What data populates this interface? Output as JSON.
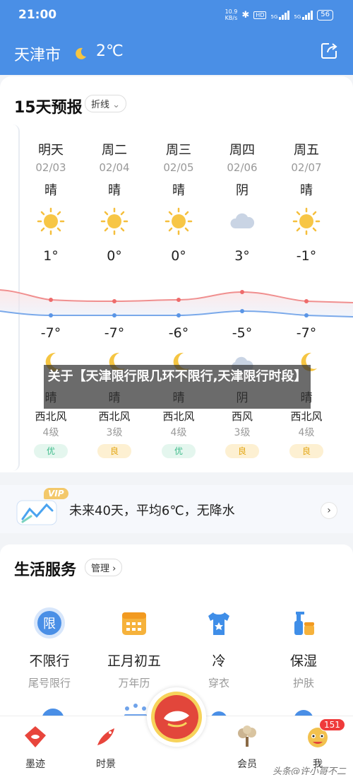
{
  "status_bar": {
    "time": "21:00",
    "net_speed": "10.9\nKB/s",
    "hd_label": "HD",
    "sig1": "5G",
    "sig2": "5G",
    "battery": "56"
  },
  "header": {
    "city": "天津市",
    "temperature": "2℃",
    "weather_icon": "crescent-moon-icon",
    "share_icon": "share-icon"
  },
  "forecast": {
    "title": "15天预报",
    "view_selector": "折线",
    "days": [
      {
        "name": "明天",
        "date": "02/03",
        "condition": "晴",
        "high": "1°",
        "low": "-7°",
        "night_condition": "晴",
        "wind": "西北风",
        "wind_level": "4级",
        "aqi": "优",
        "icon": "sun-icon",
        "night_icon": "moon-icon"
      },
      {
        "name": "周二",
        "date": "02/04",
        "condition": "晴",
        "high": "0°",
        "low": "-7°",
        "night_condition": "晴",
        "wind": "西北风",
        "wind_level": "3级",
        "aqi": "良",
        "icon": "sun-icon",
        "night_icon": "moon-icon"
      },
      {
        "name": "周三",
        "date": "02/05",
        "condition": "晴",
        "high": "0°",
        "low": "-6°",
        "night_condition": "晴",
        "wind": "西北风",
        "wind_level": "4级",
        "aqi": "优",
        "icon": "sun-icon",
        "night_icon": "moon-icon"
      },
      {
        "name": "周四",
        "date": "02/06",
        "condition": "阴",
        "high": "3°",
        "low": "-5°",
        "night_condition": "阴",
        "wind": "西风",
        "wind_level": "3级",
        "aqi": "良",
        "icon": "cloud-icon",
        "night_icon": "cloud-icon"
      },
      {
        "name": "周五",
        "date": "02/07",
        "condition": "晴",
        "high": "-1°",
        "low": "-7°",
        "night_condition": "晴",
        "wind": "西北风",
        "wind_level": "4级",
        "aqi": "良",
        "icon": "sun-icon",
        "night_icon": "moon-icon"
      }
    ],
    "colors": {
      "aqi_good": "#3dbb8a",
      "aqi_moderate": "#f0b52a",
      "high_line": "#f08080",
      "low_line": "#6fa3ea"
    }
  },
  "overlay": {
    "text": "关于【天津限行限几环不限行,天津限行时段】"
  },
  "promo": {
    "badge": "VIP",
    "text": "未来40天，平均6℃，无降水",
    "arrow": "›"
  },
  "life_services": {
    "title": "生活服务",
    "manage": "管理 ›",
    "items": [
      {
        "main": "不限行",
        "sub": "尾号限行",
        "icon": "restriction-icon",
        "glyph": "限"
      },
      {
        "main": "正月初五",
        "sub": "万年历",
        "icon": "calendar-icon"
      },
      {
        "main": "冷",
        "sub": "穿衣",
        "icon": "tshirt-icon"
      },
      {
        "main": "保湿",
        "sub": "护肤",
        "icon": "skincare-icon"
      }
    ]
  },
  "tabbar": {
    "items": [
      {
        "label": "墨迹",
        "icon": "moji-home-icon"
      },
      {
        "label": "时景",
        "icon": "koi-fish-icon"
      },
      {
        "label": "会员",
        "icon": "tree-icon"
      },
      {
        "label": "我",
        "icon": "lion-dance-icon"
      }
    ],
    "badge": "151"
  },
  "watermark": "头条@许小哥不二"
}
